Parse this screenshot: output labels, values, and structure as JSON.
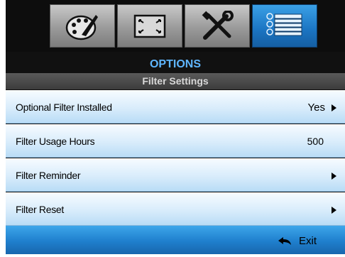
{
  "tabs": [
    {
      "icon": "palette-icon",
      "active": false
    },
    {
      "icon": "screen-resize-icon",
      "active": false
    },
    {
      "icon": "tools-icon",
      "active": false
    },
    {
      "icon": "options-list-icon",
      "active": true
    }
  ],
  "header": {
    "title": "OPTIONS",
    "subtitle": "Filter Settings"
  },
  "rows": [
    {
      "label": "Optional Filter Installed",
      "value": "Yes",
      "has_arrow": true
    },
    {
      "label": "Filter Usage Hours",
      "value": "500",
      "has_arrow": false
    },
    {
      "label": "Filter Reminder",
      "value": "",
      "has_arrow": true
    },
    {
      "label": "Filter Reset",
      "value": "",
      "has_arrow": true
    }
  ],
  "footer": {
    "exit_label": "Exit",
    "exit_icon": "return-arrow-icon"
  },
  "colors": {
    "accent": "#1f7fcd",
    "title": "#5fb6ff"
  }
}
